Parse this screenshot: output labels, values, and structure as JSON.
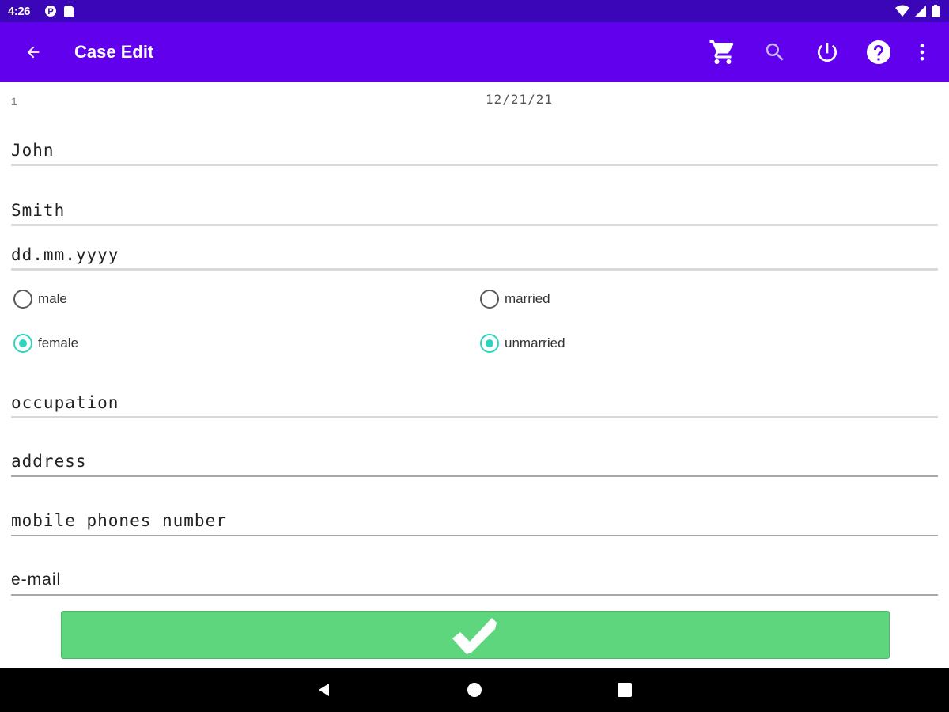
{
  "status_bar": {
    "time": "4:26",
    "icons": [
      "notification-icon",
      "sim-card-icon",
      "wifi-icon",
      "cell-signal-icon",
      "battery-icon"
    ]
  },
  "app_bar": {
    "title": "Case Edit",
    "actions": [
      "cart-icon",
      "search-icon",
      "power-icon",
      "help-icon",
      "more-vert-icon"
    ],
    "color": "#6100ed"
  },
  "case": {
    "number": "1",
    "date": "12/21/21"
  },
  "form": {
    "first_name": {
      "value": "John"
    },
    "last_name": {
      "value": "Smith"
    },
    "birth_date": {
      "placeholder": "dd.mm.yyyy"
    },
    "gender": {
      "options": [
        "male",
        "female"
      ],
      "selected": "female"
    },
    "marital_status": {
      "options": [
        "married",
        "unmarried"
      ],
      "selected": "unmarried"
    },
    "occupation": {
      "placeholder": "occupation"
    },
    "address": {
      "placeholder": "address"
    },
    "mobile": {
      "placeholder": "mobile phones number"
    },
    "email": {
      "placeholder": "e-mail"
    }
  },
  "submit": {
    "icon": "checkmark-icon",
    "color": "#5dd67e"
  },
  "nav": [
    "back-nav-icon",
    "home-nav-icon",
    "recents-nav-icon"
  ],
  "accent_color": "#2ed4c2"
}
